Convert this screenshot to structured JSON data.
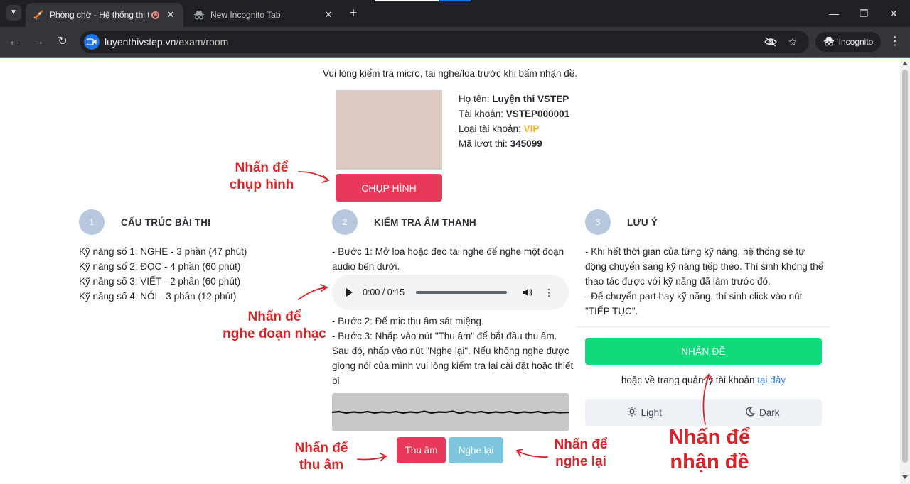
{
  "browser": {
    "tabs": [
      {
        "title": "Phòng chờ - Hệ thống thi thử",
        "active": true
      },
      {
        "title": "New Incognito Tab",
        "active": false
      }
    ],
    "url_domain": "luyenthivstep.vn",
    "url_path": "/exam/room",
    "incognito_label": "Incognito"
  },
  "notice": "Vui lòng kiểm tra micro, tai nghe/loa trước khi bấm nhận đề.",
  "capture_button": "CHỤP HÌNH",
  "profile": {
    "name_label": "Họ tên: ",
    "name": "Luyện thi VSTEP",
    "account_label": "Tài khoản: ",
    "account": "VSTEP000001",
    "type_label": "Loại tài khoản: ",
    "type": "VIP",
    "attempt_label": "Mã lượt thi: ",
    "attempt": "345099"
  },
  "col1": {
    "step": "1",
    "title": "CẤU TRÚC BÀI THI",
    "lines": [
      "Kỹ năng số 1: NGHE - 3 phần (47 phút)",
      "Kỹ năng số 2: ĐỌC - 4 phần (60 phút)",
      "Kỹ năng số 3: VIẾT - 2 phần (60 phút)",
      "Kỹ năng số 4: NÓI - 3 phần (12 phút)"
    ]
  },
  "col2": {
    "step": "2",
    "title": "KIỂM TRA ÂM THANH",
    "step1": "- Bước 1: Mở loa hoặc đeo tai nghe để nghe một đoạn audio bên dưới.",
    "audio_time": "0:00 / 0:15",
    "step2": "- Bước 2: Để mic thu âm sát miệng.",
    "step3": "- Bước 3: Nhấp vào nút \"Thu âm\" để bắt đầu thu âm. Sau đó, nhấp vào nút \"Nghe lại\". Nếu không nghe được giọng nói của mình vui lòng kiểm tra lại cài đặt hoặc thiết bị.",
    "record_button": "Thu âm",
    "replay_button": "Nghe lại"
  },
  "col3": {
    "step": "3",
    "title": "LƯU Ý",
    "note1": "- Khi hết thời gian của từng kỹ năng, hệ thống sẽ tự động chuyển sang kỹ năng tiếp theo. Thí sinh không thể thao tác được với kỹ năng đã làm trước đó.",
    "note2": "- Để chuyển part hay kỹ năng, thí sinh click vào nút \"TIẾP TỤC\".",
    "get_exam_button": "NHẬN ĐỀ",
    "back_text": "hoặc về trang quản lý tài khoản ",
    "back_link": "tại đây",
    "light_label": "Light",
    "dark_label": "Dark"
  },
  "annotations": {
    "capture": [
      "Nhấn để",
      "chụp hình"
    ],
    "listen": [
      "Nhấn để",
      "nghe đoạn nhạc"
    ],
    "record": [
      "Nhấn để",
      "thu âm"
    ],
    "replay": [
      "Nhấn để",
      "nghe lại"
    ],
    "get_exam": [
      "Nhấn để",
      "nhận đề"
    ]
  },
  "colors": {
    "accent_red": "#e8395a",
    "accent_green": "#12d97a",
    "replay_blue": "#7ec4dc",
    "annotation_red": "#d7262a",
    "vip_gold": "#f0b429"
  }
}
